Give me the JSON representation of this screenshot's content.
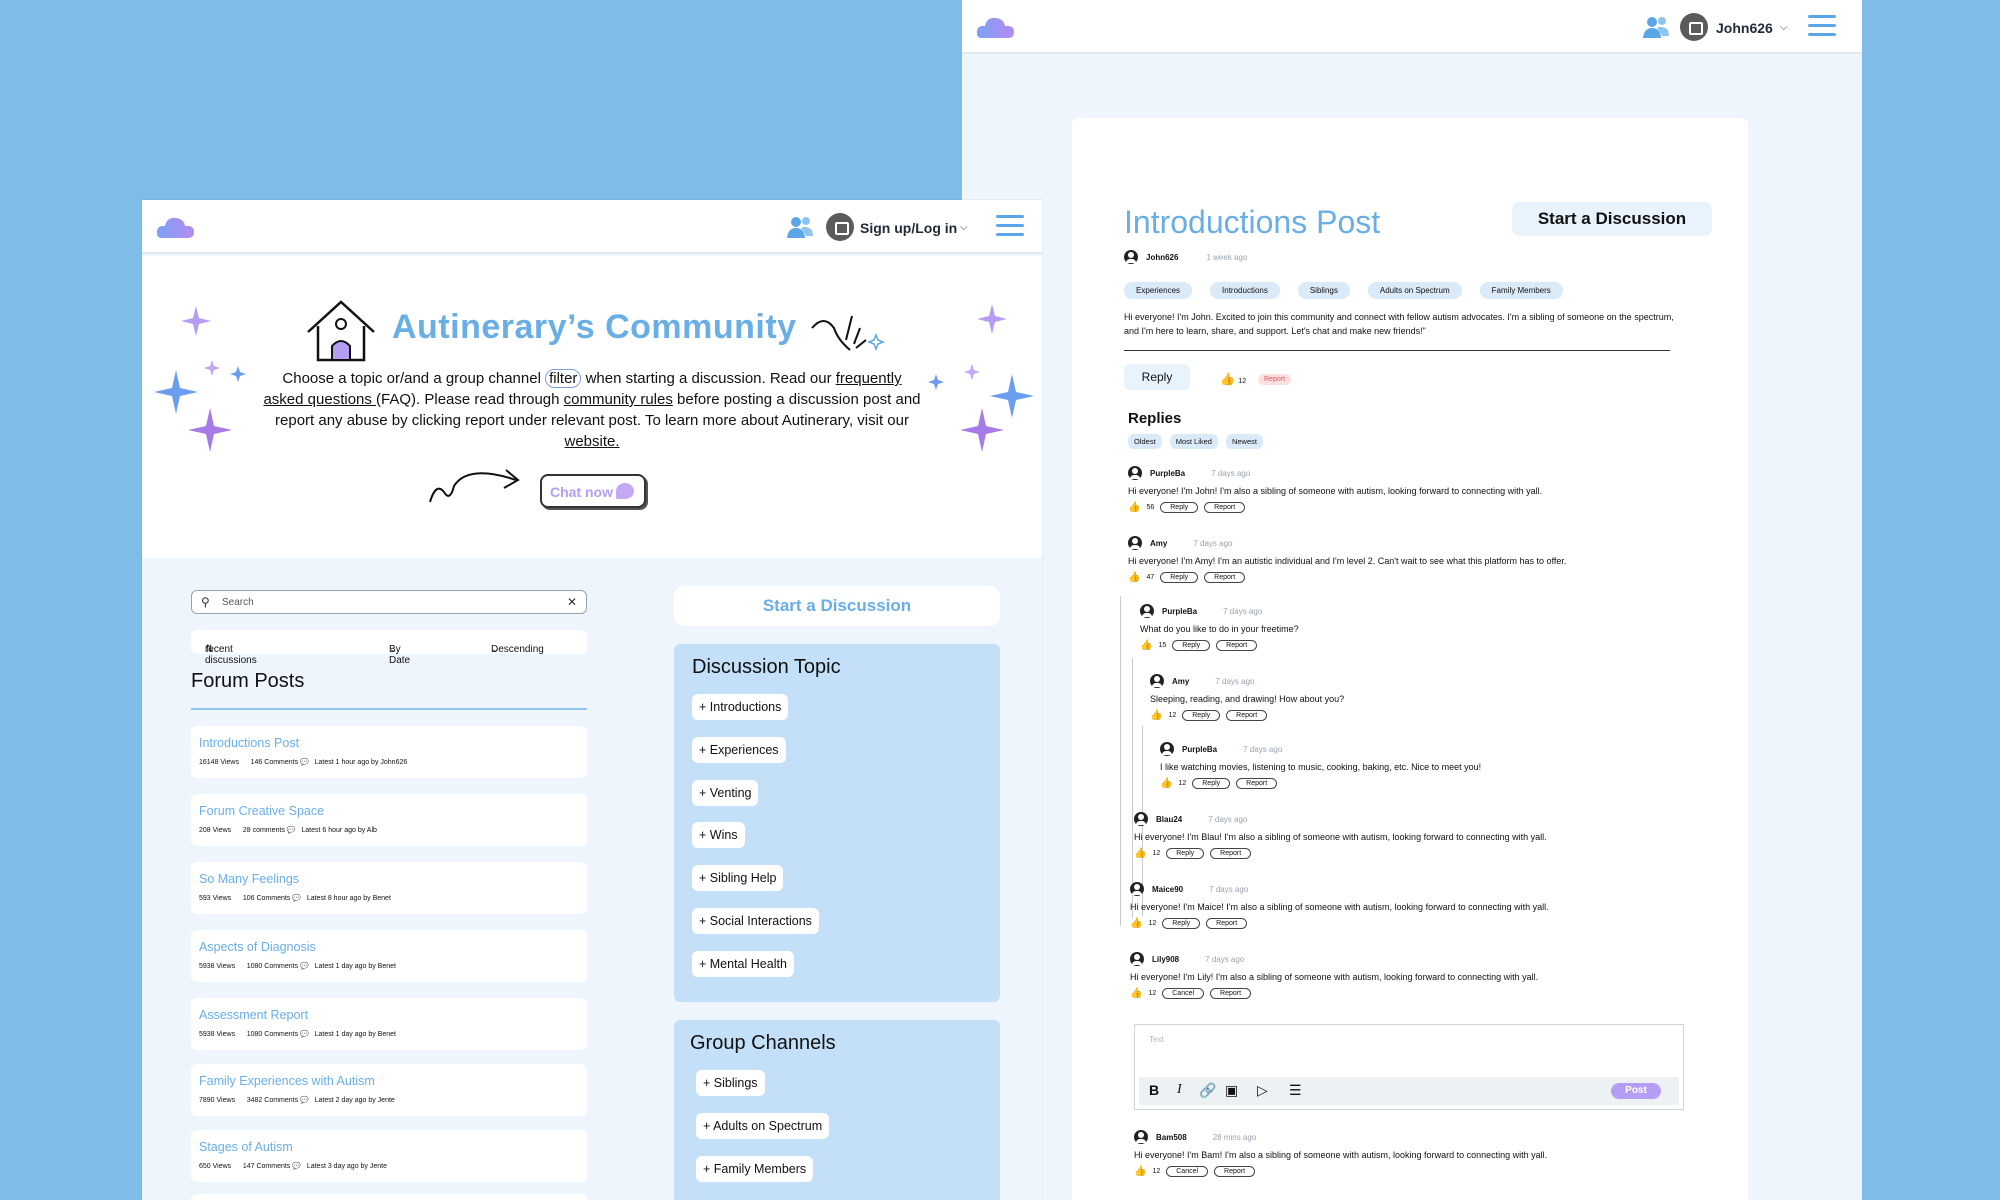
{
  "colors": {
    "background": "#7fbce8",
    "accent": "#6aaee6",
    "panel": "#c4e0f8",
    "purple": "#b49df2"
  },
  "back_window": {
    "nav": {
      "username": "John626"
    },
    "post": {
      "title": "Introductions Post",
      "start_button": "Start a Discussion",
      "author": "John626",
      "time": "1 week ago",
      "tags": [
        "Experiences",
        "Introductions",
        "Siblings",
        "Adults on Spectrum",
        "Family Members"
      ],
      "body": "Hi everyone! I'm John. Excited to join this community and connect with fellow autism advocates. I'm a sibling of someone on the spectrum, and I'm here to learn, share, and support. Let's chat and make new friends!\"",
      "reply_label": "Reply",
      "likes": "12",
      "report_label": "Report"
    },
    "replies_heading": "Replies",
    "sort_options": [
      "Oldest",
      "Most Liked",
      "Newest"
    ],
    "replies": [
      {
        "user": "PurpleBa",
        "time": "7 days ago",
        "text": "Hi everyone! I'm John! I'm also a sibling of someone with autism, looking forward to connecting with yall.",
        "likes": "56",
        "a1": "Reply",
        "a2": "Report"
      },
      {
        "user": "Amy",
        "time": "7 days ago",
        "text": "Hi everyone! I'm Amy! I'm an autistic individual and I'm level 2. Can't wait to see what this platform has to offer.",
        "likes": "47",
        "a1": "Reply",
        "a2": "Report"
      },
      {
        "user": "PurpleBa",
        "time": "7 days ago",
        "text": "What do you like to do in your freetime?",
        "likes": "15",
        "a1": "Reply",
        "a2": "Report"
      },
      {
        "user": "Amy",
        "time": "7 days ago",
        "text": "Sleeping, reading, and drawing! How about you?",
        "likes": "12",
        "a1": "Reply",
        "a2": "Report"
      },
      {
        "user": "PurpleBa",
        "time": "7 days ago",
        "text": "I like watching movies, listening to music, cooking, baking, etc. Nice to meet you!",
        "likes": "12",
        "a1": "Reply",
        "a2": "Report"
      },
      {
        "user": "Blau24",
        "time": "7 days ago",
        "text": "Hi everyone! I'm Blau! I'm also a sibling of someone with autism, looking forward to connecting with yall.",
        "likes": "12",
        "a1": "Reply",
        "a2": "Report"
      },
      {
        "user": "Maice90",
        "time": "7 days ago",
        "text": "Hi everyone! I'm Maice! I'm also a sibling of someone with autism, looking forward to connecting with yall.",
        "likes": "12",
        "a1": "Reply",
        "a2": "Report"
      },
      {
        "user": "Lily908",
        "time": "7 days ago",
        "text": "Hi everyone! I'm Lily! I'm also a sibling of someone with autism, looking forward to connecting with yall.",
        "likes": "12",
        "a1": "Cancel",
        "a2": "Report"
      },
      {
        "user": "Bam508",
        "time": "28 mins ago",
        "text": "Hi everyone! I'm Bam! I'm also a sibling of someone with autism, looking forward to connecting with yall.",
        "likes": "12",
        "a1": "Cancel",
        "a2": "Report"
      }
    ],
    "editor": {
      "placeholder": "Text",
      "post_button": "Post"
    }
  },
  "front_window": {
    "nav": {
      "login": "Sign up/Log in"
    },
    "hero": {
      "title": "Autinerary’s Community",
      "t1": "Choose a topic or/and a group channel ",
      "filter": "filter",
      "t2": " when starting a discussion. Read our ",
      "faq": "frequently asked questions ",
      "t3": "(FAQ). Please read through ",
      "rules": "community rules",
      "t4": " before posting a discussion post and report any abuse by clicking report under relevant post. To learn more about Autinerary, visit our",
      "website": " website.",
      "chat": "Chat now"
    },
    "search": {
      "placeholder": "Search"
    },
    "filters": {
      "recent": "recent discussions",
      "by": "By Date",
      "order": "Descending"
    },
    "forum_heading": "Forum Posts",
    "forum_posts": [
      {
        "title": "Introductions Post",
        "views": "16148 Views",
        "comments": "146 Comments",
        "latest": "Latest 1 hour ago by John626"
      },
      {
        "title": "Forum Creative Space",
        "views": "208 Views",
        "comments": "28 comments",
        "latest": "Latest 6 hour ago by Alb"
      },
      {
        "title": "So Many Feelings",
        "views": "593 Views",
        "comments": "106 Comments",
        "latest": "Latest 8 hour ago by Benet"
      },
      {
        "title": "Aspects of Diagnosis",
        "views": "5938 Views",
        "comments": "1080 Comments",
        "latest": "Latest 1 day ago by Benet"
      },
      {
        "title": "Assessment Report",
        "views": "5938 Views",
        "comments": "1080 Comments",
        "latest": "Latest 1 day ago by Benet"
      },
      {
        "title": "Family Experiences with Autism",
        "views": "7890 Views",
        "comments": "3482 Comments",
        "latest": "Latest 2 day ago by Jente"
      },
      {
        "title": "Stages of Autism",
        "views": "650 Views",
        "comments": "147 Comments",
        "latest": "Latest 3 day ago by Jente"
      }
    ],
    "start_button": "Start a Discussion",
    "topic_heading": "Discussion Topic",
    "topics": [
      "+ Introductions",
      "+ Experiences",
      "+ Venting",
      "+ Wins",
      "+ Sibling Help",
      "+ Social Interactions",
      "+ Mental Health"
    ],
    "channels_heading": "Group Channels",
    "channels": [
      "+ Siblings",
      "+ Adults on Spectrum",
      "+ Family Members"
    ]
  }
}
